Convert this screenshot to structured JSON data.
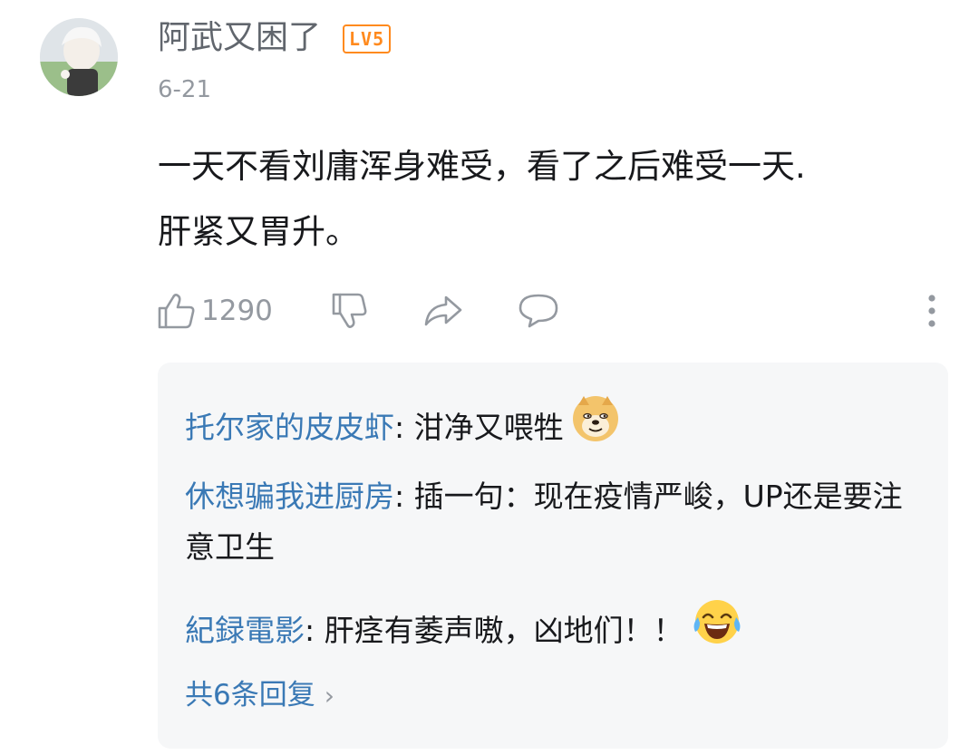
{
  "comment": {
    "username": "阿武又困了",
    "level_badge": "LV5",
    "timestamp": "6-21",
    "text_line1": "一天不看刘庸浑身难受，看了之后难受一天.",
    "text_line2": "肝紧又胃升。",
    "like_count": "1290"
  },
  "icons": {
    "like": "thumbs-up-icon",
    "dislike": "thumbs-down-icon",
    "share": "share-icon",
    "reply": "comment-bubble-icon",
    "more": "vertical-ellipsis-icon",
    "emoji_doge": "doge-emoji",
    "emoji_laugh": "laughing-tears-emoji"
  },
  "replies": [
    {
      "author": "托尔家的皮皮虾",
      "separator": ": ",
      "text": "泔净又喂牲"
    },
    {
      "author": "休想骗我进厨房",
      "separator": ": ",
      "text": "插一句：现在疫情严峻，UP还是要注意卫生"
    },
    {
      "author": "紀録電影",
      "separator": ": ",
      "text": "肝痉有萎声嗷，凶地们！！"
    }
  ],
  "see_all_label": "共6条回复",
  "see_all_chevron": "›",
  "colors": {
    "link_blue": "#3a79b5",
    "level_orange": "#ff8a1e",
    "secondary_gray": "#9499a0",
    "reply_bg": "#f6f7f8"
  }
}
